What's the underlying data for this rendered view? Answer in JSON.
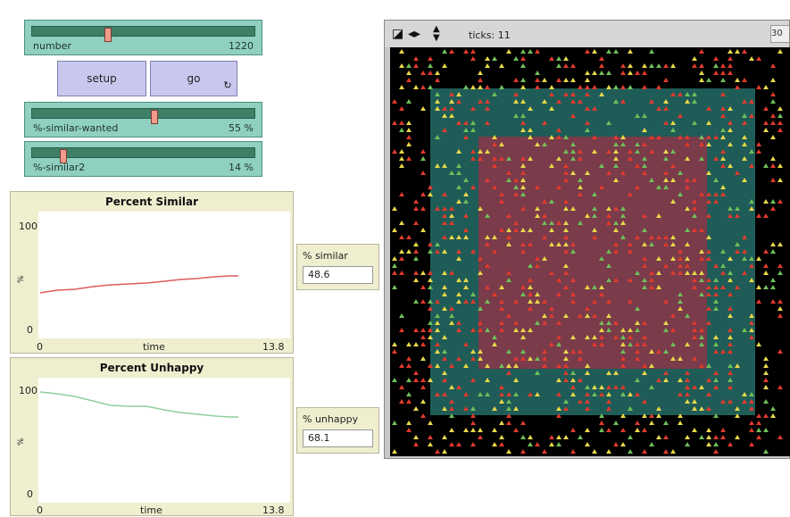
{
  "sliders": [
    {
      "name": "number",
      "value": "1220",
      "fraction": 0.34
    },
    {
      "name": "%-similar-wanted",
      "value": "55 %",
      "fraction": 0.55
    },
    {
      "name": "%-similar2",
      "value": "14 %",
      "fraction": 0.14
    }
  ],
  "buttons": {
    "setup": "setup",
    "go": "go"
  },
  "plots": [
    {
      "title": "Percent Similar",
      "ymax_label": "100",
      "ymin_label": "0",
      "xmin_label": "0",
      "xmax_label": "13.8",
      "xlabel": "time",
      "ylabel": "%",
      "color": "#e05a5a"
    },
    {
      "title": "Percent Unhappy",
      "ymax_label": "100",
      "ymin_label": "0",
      "xmin_label": "0",
      "xmax_label": "13.8",
      "xlabel": "time",
      "ylabel": "%",
      "color": "#8fcf9a"
    }
  ],
  "monitors": {
    "similar": {
      "label": "% similar",
      "value": "48.6"
    },
    "unhappy": {
      "label": "% unhappy",
      "value": "68.1"
    }
  },
  "view": {
    "ticks": "ticks: 11",
    "speed": "30"
  },
  "colors": {
    "outer_patch": "#000000",
    "middle_patch": "#1f5c57",
    "inner_patch": "#7a3b4a",
    "turtle_red": "#e03a2e",
    "turtle_yellow": "#e8d84a",
    "turtle_green": "#6fbf5a"
  }
}
